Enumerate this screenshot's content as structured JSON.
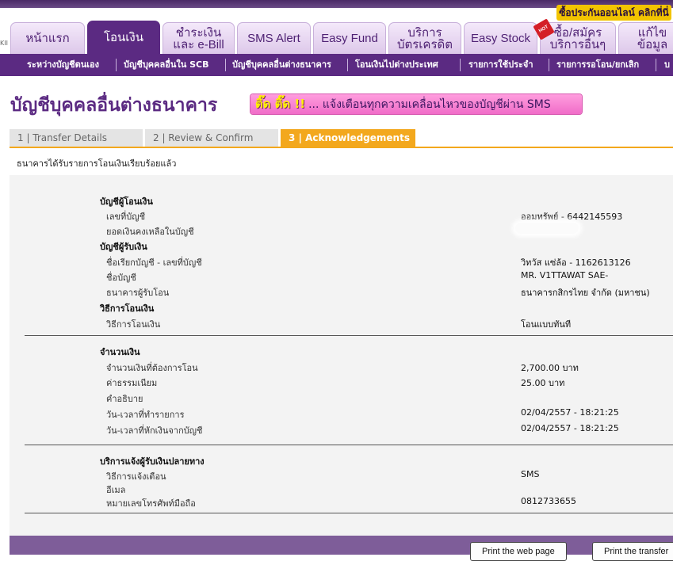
{
  "promo_link": "ซื้อประกันออนไลน์ คลิกที่นี่",
  "main_nav": [
    {
      "label": "หน้าแรก"
    },
    {
      "label": "โอนเงิน"
    },
    {
      "label": "ชำระเงิน\nและ e-Bill"
    },
    {
      "label": "SMS Alert"
    },
    {
      "label": "Easy Fund"
    },
    {
      "label": "บริการ\nบัตรเครดิต"
    },
    {
      "label": "Easy Stock"
    },
    {
      "label": "ซื้อ/สมัคร\nบริการอื่นๆ",
      "badge": "HOT"
    },
    {
      "label": "แก้ไขข้อมูล"
    }
  ],
  "main_nav_prefix": "KII",
  "sub_nav": [
    {
      "label": "ระหว่างบัญชีตนเอง"
    },
    {
      "label": "บัญชีบุคคลอื่นใน SCB"
    },
    {
      "label": "บัญชีบุคคลอื่นต่างธนาคาร"
    },
    {
      "label": "โอนเงินไปต่างประเทศ"
    },
    {
      "label": "รายการใช้ประจำ"
    },
    {
      "label": "รายการรอโอน/ยกเลิก"
    },
    {
      "label": "บ"
    }
  ],
  "page_title": "บัญชีบุคคลอื่นต่างธนาคาร",
  "sms_banner": {
    "tick": "ติ๊ด ติ๊ด !!",
    "message": "... แจ้งเตือนทุกความเคลื่อนไหวของบัญชีผ่าน SMS"
  },
  "steps": [
    {
      "label": "1 | Transfer Details"
    },
    {
      "label": "2 | Review & Confirm"
    },
    {
      "label": "3 | Acknowledgements"
    }
  ],
  "confirmation_message": "ธนาคารได้รับรายการโอนเงินเรียบร้อยแล้ว",
  "from_account": {
    "heading": "บัญชีผู้โอนเงิน",
    "number_label": "เลขที่บัญชี",
    "number_value": "ออมทรัพย์ - 6442145593",
    "balance_label": "ยอดเงินคงเหลือในบัญชี"
  },
  "to_account": {
    "heading": "บัญชีผู้รับเงิน",
    "nickname_label": "ชื่อเรียกบัญชี - เลขที่บัญชี",
    "nickname_value": "วิทวัส แซ่ล้อ - 1162613126",
    "name_label": "ชื่อบัญชี",
    "name_value": "MR. V1TTAWAT SAE-",
    "bank_label": "ธนาคารผู้รับโอน",
    "bank_value": "ธนาคารกสิกรไทย จำกัด (มหาชน)"
  },
  "method": {
    "heading": "วิธีการโอนเงิน",
    "label": "วิธีการโอนเงิน",
    "value": "โอนแบบทันที"
  },
  "amount": {
    "heading": "จำนวนเงิน",
    "amount_label": "จำนวนเงินที่ต้องการโอน",
    "amount_value": "2,700.00 บาท",
    "fee_label": "ค่าธรรมเนียม",
    "fee_value": "25.00  บาท",
    "desc_label": "คำอธิบาย",
    "tx_time_label": "วัน-เวลาที่ทำรายการ",
    "tx_time_value": "02/04/2557 - 18:21:25",
    "debit_time_label": "วัน-เวลาที่หักเงินจากบัญชี",
    "debit_time_value": "02/04/2557 - 18:21:25"
  },
  "notify": {
    "heading": "บริการแจ้งผู้รับเงินปลายทาง",
    "method_label": "วิธีการแจ้งเตือน",
    "method_value": "SMS",
    "email_label": "อีเมล",
    "phone_label": "หมายเลขโทรศัพท์มือถือ",
    "phone_value": "0812733655"
  },
  "buttons": {
    "print_page": "Print the web page",
    "print_transfer": "Print the transfer"
  },
  "colors": {
    "brand_purple": "#5b2a82",
    "step_active": "#f3a81d",
    "promo_yellow": "#f2c400",
    "banner_pink": "#f06cc8"
  }
}
